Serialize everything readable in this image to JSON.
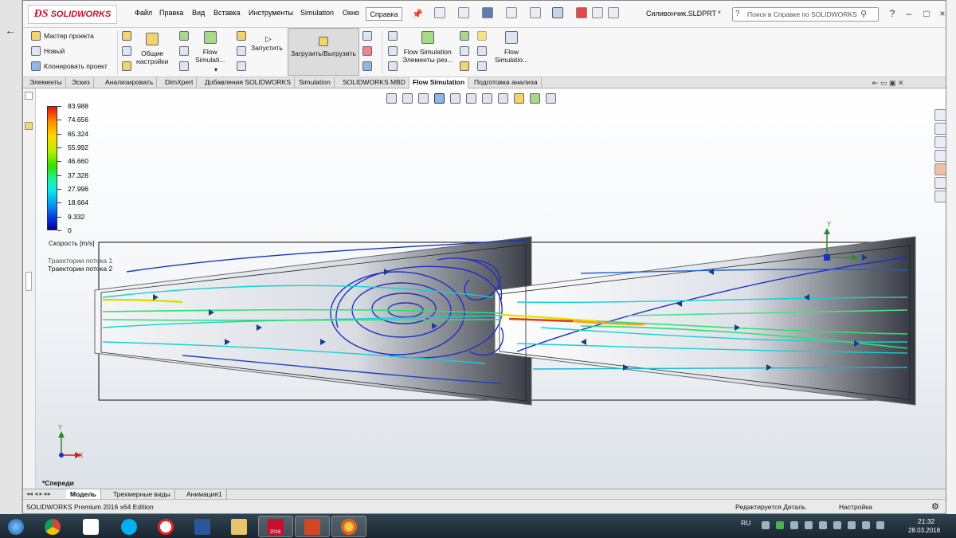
{
  "app": {
    "brand": "SOLIDWORKS",
    "document_title": "Силивончик.SLDPRT *",
    "menu": [
      "Файл",
      "Правка",
      "Вид",
      "Вставка",
      "Инструменты",
      "Simulation",
      "Окно"
    ],
    "help_menu": "Справка",
    "search_placeholder": "Поиск в Справке по SOLIDWORKS",
    "win_controls": [
      "?",
      "–",
      "□",
      "×"
    ]
  },
  "commands": {
    "left_group": [
      "Мастер проекта",
      "Новый",
      "Клонировать проект"
    ],
    "general_settings": [
      "Общие",
      "настройки"
    ],
    "flow_sim_1": [
      "Flow",
      "Simulati..."
    ],
    "run": "Запустить",
    "load_unload": "Загрузить/Выгрузить",
    "flow_sim_elements": [
      "Flow Simulation",
      "Элементы рез..."
    ],
    "flow_sim_2": [
      "Flow",
      "Simulatio..."
    ]
  },
  "tabs": [
    "Элементы",
    "Эскиз",
    "Анализировать",
    "DimXpert",
    "Добавления SOLIDWORKS",
    "Simulation",
    "SOLIDWORKS MBD",
    "Flow Simulation",
    "Подготовка анализа"
  ],
  "active_tab": "Flow Simulation",
  "legend": {
    "values": [
      "83.988",
      "74.656",
      "65.324",
      "55.992",
      "46.660",
      "37.328",
      "27.996",
      "18.664",
      "9.332",
      "0"
    ],
    "title": "Скорость [m/s]",
    "trajectories": [
      "Траектории потока 1",
      "Траектории потока 2"
    ]
  },
  "view": {
    "orientation_label": "*Спереди",
    "triad_x": "X",
    "triad_y": "Y",
    "ref_triad_y": "Y"
  },
  "bottom_tabs": [
    "Модель",
    "Трехмерные виды",
    "Анимация1"
  ],
  "active_bottom_tab": "Модель",
  "status": {
    "edition": "SOLIDWORKS Premium 2016 x64 Edition",
    "editing": "Редактируется Деталь",
    "settings": "Настройка"
  },
  "taskbar": {
    "lang": "RU",
    "time": "21:32",
    "date": "28.03.2018",
    "sw_badge": "2016",
    "apps": [
      "start-orb",
      "chrome",
      "yandex",
      "skype",
      "yandex-browser",
      "word",
      "file-explorer",
      "solidworks",
      "presentation",
      "app-target"
    ]
  },
  "colors": {
    "brand_red": "#c8102e",
    "stream_blue": "#1a2fc8",
    "stream_cyan": "#12d8d8",
    "stream_green": "#2fe07a",
    "stream_red": "#e23a10"
  }
}
